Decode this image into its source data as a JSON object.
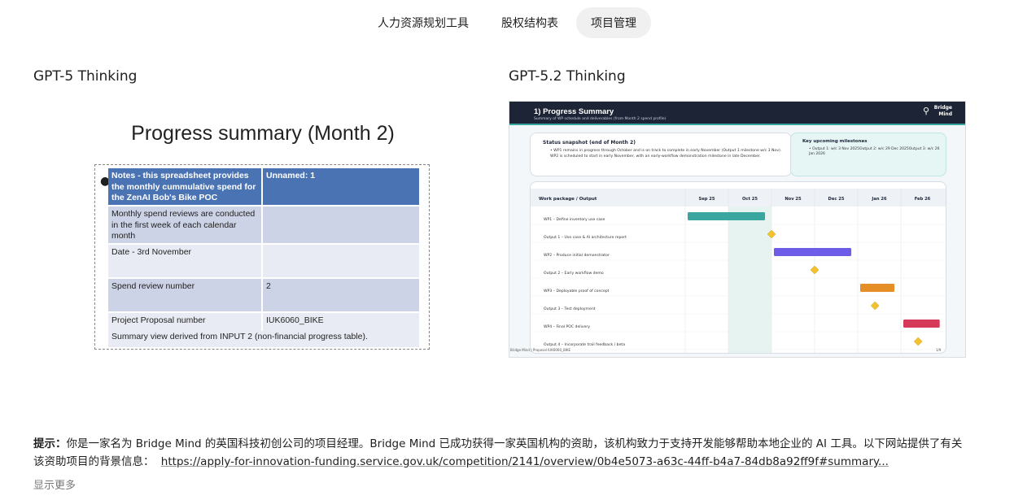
{
  "tabs": [
    "人力资源规划工具",
    "股权结构表",
    "项目管理"
  ],
  "active_tab": 2,
  "left": {
    "model": "GPT-5 Thinking",
    "heading": "Progress summary (Month 2)",
    "rows": [
      [
        "Notes - this spreadsheet provides the monthly cummulative spend for the ZenAI Bob's Bike POC depolyment",
        "Unnamed: 1"
      ],
      [
        "Monthly spend reviews are conducted in the first week of each calendar month",
        ""
      ],
      [
        "Date - 3rd November",
        ""
      ],
      [
        "Spend review number",
        "2"
      ],
      [
        "Project Proposal number",
        "IUK6060_BIKE"
      ]
    ],
    "footnote": "Summary view derived from INPUT 2 (non-financial progress table)."
  },
  "right": {
    "model": "GPT-5.2 Thinking",
    "slide_title": "1) Progress Summary",
    "slide_subtitle": "Summary of WP schedule and deliverables (from Month 2 spend profile)",
    "logo": "Bridge\nMind",
    "status_title": "Status snapshot (end of Month 2)",
    "status_text": "WP1 remains in progress through October and is on track to complete in early November (Output 1 milestone w/c 3 Nov). WP2 is scheduled to start in early November, with an early-workflow demonstration milestone in late December.",
    "milestones_title": "Key upcoming milestones",
    "milestones_text": "Output 1: w/c 3 Nov 2025Output 2: w/c 29 Dec 2025Output 3: w/c 26 Jan 2026",
    "gantt_header": "Work package / Output",
    "months": [
      "Sep 25",
      "Oct 25",
      "Nov 25",
      "Dec 25",
      "Jan 26",
      "Feb 26"
    ],
    "tasks": [
      {
        "label": "WP1 – Define inventory use case",
        "kind": "bar",
        "start": 0,
        "end": 1.85,
        "color": "#3aa6a0"
      },
      {
        "label": "Output 1 – Use case & AI architecture report",
        "kind": "milestone",
        "at": 2.0,
        "color": "#f2c12e"
      },
      {
        "label": "WP2 – Produce initial demonstrator",
        "kind": "bar",
        "start": 2.0,
        "end": 3.85,
        "color": "#6c5ce7"
      },
      {
        "label": "Output 2 – Early workflow demo",
        "kind": "milestone",
        "at": 3.0,
        "color": "#f2c12e"
      },
      {
        "label": "WP3 – Deployable proof of concept",
        "kind": "bar",
        "start": 4.0,
        "end": 4.85,
        "color": "#e58e26"
      },
      {
        "label": "Output 3 – Test deployment",
        "kind": "milestone",
        "at": 4.4,
        "color": "#f2c12e"
      },
      {
        "label": "WP4 – Final POC delivery",
        "kind": "bar",
        "start": 5.0,
        "end": 5.9,
        "color": "#d63a5a"
      },
      {
        "label": "Output 4 – Incorporate trail feedback / beta",
        "kind": "milestone",
        "at": 5.4,
        "color": "#f2c12e"
      }
    ],
    "footer_left": "Bridge Mind | Proposal IUK6060_BIKE",
    "footer_right": "1/9"
  },
  "prompt": {
    "label": "提示：",
    "text": "你是一家名为 Bridge Mind 的英国科技初创公司的项目经理。Bridge Mind 已成功获得一家英国机构的资助，该机构致力于支持开发能够帮助本地企业的 AI 工具。以下网站提供了有关该资助项目的背景信息：",
    "link": "https://apply-for-innovation-funding.service.gov.uk/competition/2141/overview/0b4e5073-a63c-44ff-b4a7-84db8a92ff9f#summary...",
    "show_more": "显示更多"
  }
}
